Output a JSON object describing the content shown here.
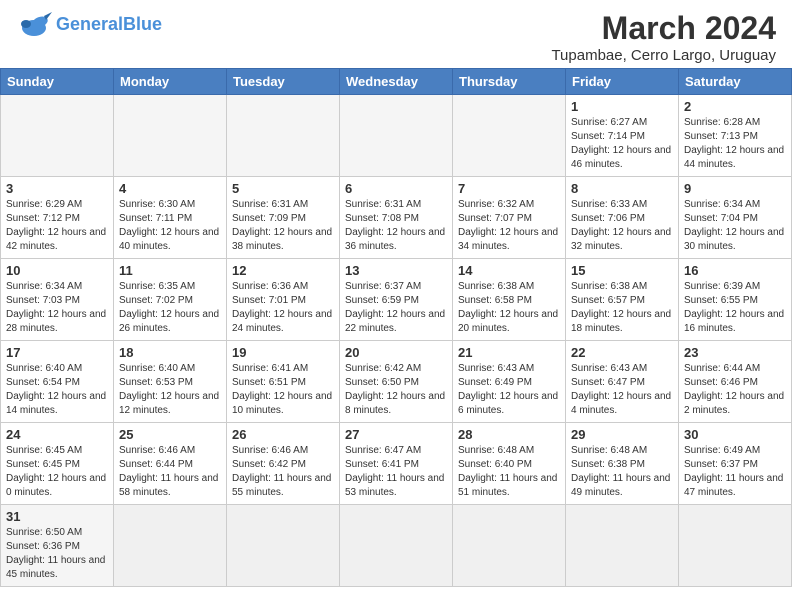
{
  "header": {
    "logo_general": "General",
    "logo_blue": "Blue",
    "month_title": "March 2024",
    "subtitle": "Tupambae, Cerro Largo, Uruguay"
  },
  "calendar": {
    "days_of_week": [
      "Sunday",
      "Monday",
      "Tuesday",
      "Wednesday",
      "Thursday",
      "Friday",
      "Saturday"
    ],
    "weeks": [
      [
        {
          "day": "",
          "info": "",
          "empty": true
        },
        {
          "day": "",
          "info": "",
          "empty": true
        },
        {
          "day": "",
          "info": "",
          "empty": true
        },
        {
          "day": "",
          "info": "",
          "empty": true
        },
        {
          "day": "",
          "info": "",
          "empty": true
        },
        {
          "day": "1",
          "info": "Sunrise: 6:27 AM\nSunset: 7:14 PM\nDaylight: 12 hours and 46 minutes."
        },
        {
          "day": "2",
          "info": "Sunrise: 6:28 AM\nSunset: 7:13 PM\nDaylight: 12 hours and 44 minutes."
        }
      ],
      [
        {
          "day": "3",
          "info": "Sunrise: 6:29 AM\nSunset: 7:12 PM\nDaylight: 12 hours and 42 minutes."
        },
        {
          "day": "4",
          "info": "Sunrise: 6:30 AM\nSunset: 7:11 PM\nDaylight: 12 hours and 40 minutes."
        },
        {
          "day": "5",
          "info": "Sunrise: 6:31 AM\nSunset: 7:09 PM\nDaylight: 12 hours and 38 minutes."
        },
        {
          "day": "6",
          "info": "Sunrise: 6:31 AM\nSunset: 7:08 PM\nDaylight: 12 hours and 36 minutes."
        },
        {
          "day": "7",
          "info": "Sunrise: 6:32 AM\nSunset: 7:07 PM\nDaylight: 12 hours and 34 minutes."
        },
        {
          "day": "8",
          "info": "Sunrise: 6:33 AM\nSunset: 7:06 PM\nDaylight: 12 hours and 32 minutes."
        },
        {
          "day": "9",
          "info": "Sunrise: 6:34 AM\nSunset: 7:04 PM\nDaylight: 12 hours and 30 minutes."
        }
      ],
      [
        {
          "day": "10",
          "info": "Sunrise: 6:34 AM\nSunset: 7:03 PM\nDaylight: 12 hours and 28 minutes."
        },
        {
          "day": "11",
          "info": "Sunrise: 6:35 AM\nSunset: 7:02 PM\nDaylight: 12 hours and 26 minutes."
        },
        {
          "day": "12",
          "info": "Sunrise: 6:36 AM\nSunset: 7:01 PM\nDaylight: 12 hours and 24 minutes."
        },
        {
          "day": "13",
          "info": "Sunrise: 6:37 AM\nSunset: 6:59 PM\nDaylight: 12 hours and 22 minutes."
        },
        {
          "day": "14",
          "info": "Sunrise: 6:38 AM\nSunset: 6:58 PM\nDaylight: 12 hours and 20 minutes."
        },
        {
          "day": "15",
          "info": "Sunrise: 6:38 AM\nSunset: 6:57 PM\nDaylight: 12 hours and 18 minutes."
        },
        {
          "day": "16",
          "info": "Sunrise: 6:39 AM\nSunset: 6:55 PM\nDaylight: 12 hours and 16 minutes."
        }
      ],
      [
        {
          "day": "17",
          "info": "Sunrise: 6:40 AM\nSunset: 6:54 PM\nDaylight: 12 hours and 14 minutes."
        },
        {
          "day": "18",
          "info": "Sunrise: 6:40 AM\nSunset: 6:53 PM\nDaylight: 12 hours and 12 minutes."
        },
        {
          "day": "19",
          "info": "Sunrise: 6:41 AM\nSunset: 6:51 PM\nDaylight: 12 hours and 10 minutes."
        },
        {
          "day": "20",
          "info": "Sunrise: 6:42 AM\nSunset: 6:50 PM\nDaylight: 12 hours and 8 minutes."
        },
        {
          "day": "21",
          "info": "Sunrise: 6:43 AM\nSunset: 6:49 PM\nDaylight: 12 hours and 6 minutes."
        },
        {
          "day": "22",
          "info": "Sunrise: 6:43 AM\nSunset: 6:47 PM\nDaylight: 12 hours and 4 minutes."
        },
        {
          "day": "23",
          "info": "Sunrise: 6:44 AM\nSunset: 6:46 PM\nDaylight: 12 hours and 2 minutes."
        }
      ],
      [
        {
          "day": "24",
          "info": "Sunrise: 6:45 AM\nSunset: 6:45 PM\nDaylight: 12 hours and 0 minutes."
        },
        {
          "day": "25",
          "info": "Sunrise: 6:46 AM\nSunset: 6:44 PM\nDaylight: 11 hours and 58 minutes."
        },
        {
          "day": "26",
          "info": "Sunrise: 6:46 AM\nSunset: 6:42 PM\nDaylight: 11 hours and 55 minutes."
        },
        {
          "day": "27",
          "info": "Sunrise: 6:47 AM\nSunset: 6:41 PM\nDaylight: 11 hours and 53 minutes."
        },
        {
          "day": "28",
          "info": "Sunrise: 6:48 AM\nSunset: 6:40 PM\nDaylight: 11 hours and 51 minutes."
        },
        {
          "day": "29",
          "info": "Sunrise: 6:48 AM\nSunset: 6:38 PM\nDaylight: 11 hours and 49 minutes."
        },
        {
          "day": "30",
          "info": "Sunrise: 6:49 AM\nSunset: 6:37 PM\nDaylight: 11 hours and 47 minutes."
        }
      ],
      [
        {
          "day": "31",
          "info": "Sunrise: 6:50 AM\nSunset: 6:36 PM\nDaylight: 11 hours and 45 minutes.",
          "last": true
        },
        {
          "day": "",
          "info": "",
          "empty": true,
          "last": true
        },
        {
          "day": "",
          "info": "",
          "empty": true,
          "last": true
        },
        {
          "day": "",
          "info": "",
          "empty": true,
          "last": true
        },
        {
          "day": "",
          "info": "",
          "empty": true,
          "last": true
        },
        {
          "day": "",
          "info": "",
          "empty": true,
          "last": true
        },
        {
          "day": "",
          "info": "",
          "empty": true,
          "last": true
        }
      ]
    ]
  }
}
